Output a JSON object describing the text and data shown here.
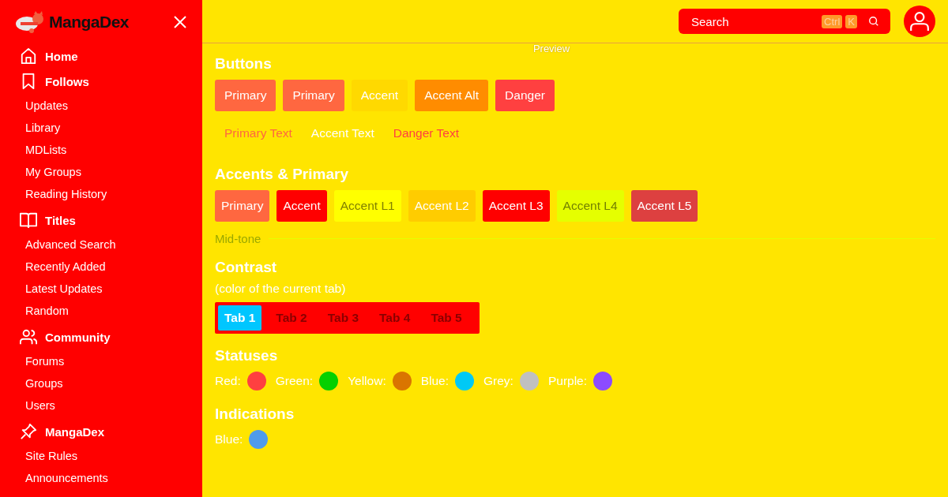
{
  "sidebar": {
    "brand": "MangaDex",
    "sections": [
      {
        "title": "Home"
      },
      {
        "title": "Follows",
        "items": [
          "Updates",
          "Library",
          "MDLists",
          "My Groups",
          "Reading History"
        ]
      },
      {
        "title": "Titles",
        "items": [
          "Advanced Search",
          "Recently Added",
          "Latest Updates",
          "Random"
        ]
      },
      {
        "title": "Community",
        "items": [
          "Forums",
          "Groups",
          "Users"
        ]
      },
      {
        "title": "MangaDex",
        "items": [
          "Site Rules",
          "Announcements"
        ]
      }
    ]
  },
  "header": {
    "search": {
      "placeholder": "Search",
      "keys": [
        "Ctrl",
        "K"
      ]
    }
  },
  "preview_title": "Preview",
  "buttons": {
    "title": "Buttons",
    "filled": [
      {
        "label": "Primary",
        "color": "#ff6740"
      },
      {
        "label": "Primary",
        "color": "#ff6740"
      },
      {
        "label": "Accent",
        "color": "#ffd900"
      },
      {
        "label": "Accent Alt",
        "color": "#ff8c00"
      },
      {
        "label": "Danger",
        "color": "#ff4040"
      }
    ],
    "text": [
      {
        "label": "Primary Text",
        "color": "#ff6740"
      },
      {
        "label": "Accent Text",
        "color": "#ffffff"
      },
      {
        "label": "Danger Text",
        "color": "#ff4040"
      }
    ]
  },
  "accents": {
    "title": "Accents & Primary",
    "swatches": [
      {
        "label": "Primary",
        "color": "#ff6740"
      },
      {
        "label": "Accent",
        "color": "#ff0000"
      },
      {
        "label": "Accent L1",
        "color": "#ffff00"
      },
      {
        "label": "Accent L2",
        "color": "#ffcc00"
      },
      {
        "label": "Accent L3",
        "color": "#ff0000"
      },
      {
        "label": "Accent L4",
        "color": "#e5ff00"
      },
      {
        "label": "Accent L5",
        "color": "#dd4040"
      }
    ],
    "midtone": "Mid-tone"
  },
  "contrast": {
    "title": "Contrast",
    "note": "(color of the current tab)",
    "tabs": [
      {
        "label": "Tab 1",
        "selected": true
      },
      {
        "label": "Tab 2",
        "selected": false
      },
      {
        "label": "Tab 3",
        "selected": false
      },
      {
        "label": "Tab 4",
        "selected": false
      },
      {
        "label": "Tab 5",
        "selected": false
      }
    ]
  },
  "statuses": {
    "title": "Statuses",
    "items": [
      {
        "label": "Red:",
        "color": "#ff4040"
      },
      {
        "label": "Green:",
        "color": "#04d000"
      },
      {
        "label": "Yellow:",
        "color": "#da7500"
      },
      {
        "label": "Blue:",
        "color": "#00c9f5"
      },
      {
        "label": "Grey:",
        "color": "#c0c0c0"
      },
      {
        "label": "Purple:",
        "color": "#8c4bff"
      }
    ]
  },
  "indications": {
    "title": "Indications",
    "items": [
      {
        "label": "Blue:",
        "color": "#4f9beb"
      }
    ]
  }
}
